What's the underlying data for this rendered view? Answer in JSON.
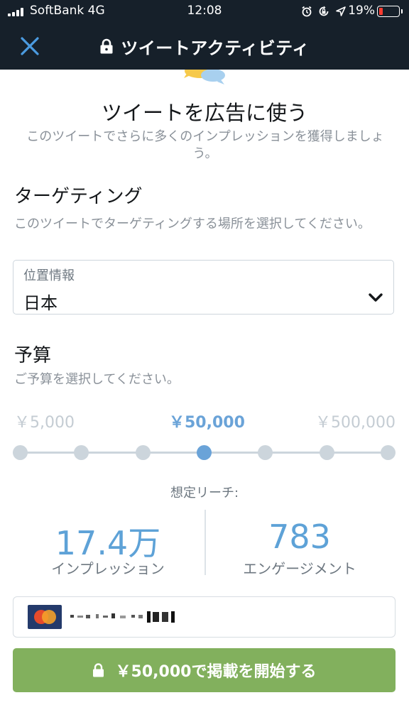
{
  "status_bar": {
    "carrier": "SoftBank",
    "network": "4G",
    "time": "12:08",
    "battery_percent": "19%",
    "icons": [
      "alarm-icon",
      "rotation-lock-icon",
      "location-arrow-icon"
    ],
    "battery_color": "#ff3b30"
  },
  "header": {
    "title": "ツイートアクティビティ",
    "close_icon": "close-icon",
    "lock_icon": "lock-icon",
    "background": "#16202a",
    "accent": "#4b9be0"
  },
  "promote": {
    "heading": "ツイートを広告に使う",
    "description": "このツイートでさらに多くのインプレッションを獲得しましょう。"
  },
  "targeting": {
    "title": "ターゲティング",
    "description": "このツイートでターゲティングする場所を選択してください。",
    "location_label": "位置情報",
    "location_value": "日本"
  },
  "budget": {
    "title": "予算",
    "description": "ご予算を選択してください。",
    "tick_labels": [
      "￥5,000",
      "￥50,000",
      "￥500,000"
    ],
    "selected_label": "￥50,000",
    "steps": 7,
    "selected_step": 3,
    "accent": "#6aa3d8"
  },
  "reach": {
    "label": "想定リーチ:",
    "impressions_value": "17.4万",
    "impressions_label": "インプレッション",
    "engagements_value": "783",
    "engagements_label": "エンゲージメント"
  },
  "payment": {
    "card_icon": "credit-card-icon"
  },
  "start_button": {
    "label": "￥50,000で掲載を開始する",
    "color": "#82b05d"
  }
}
